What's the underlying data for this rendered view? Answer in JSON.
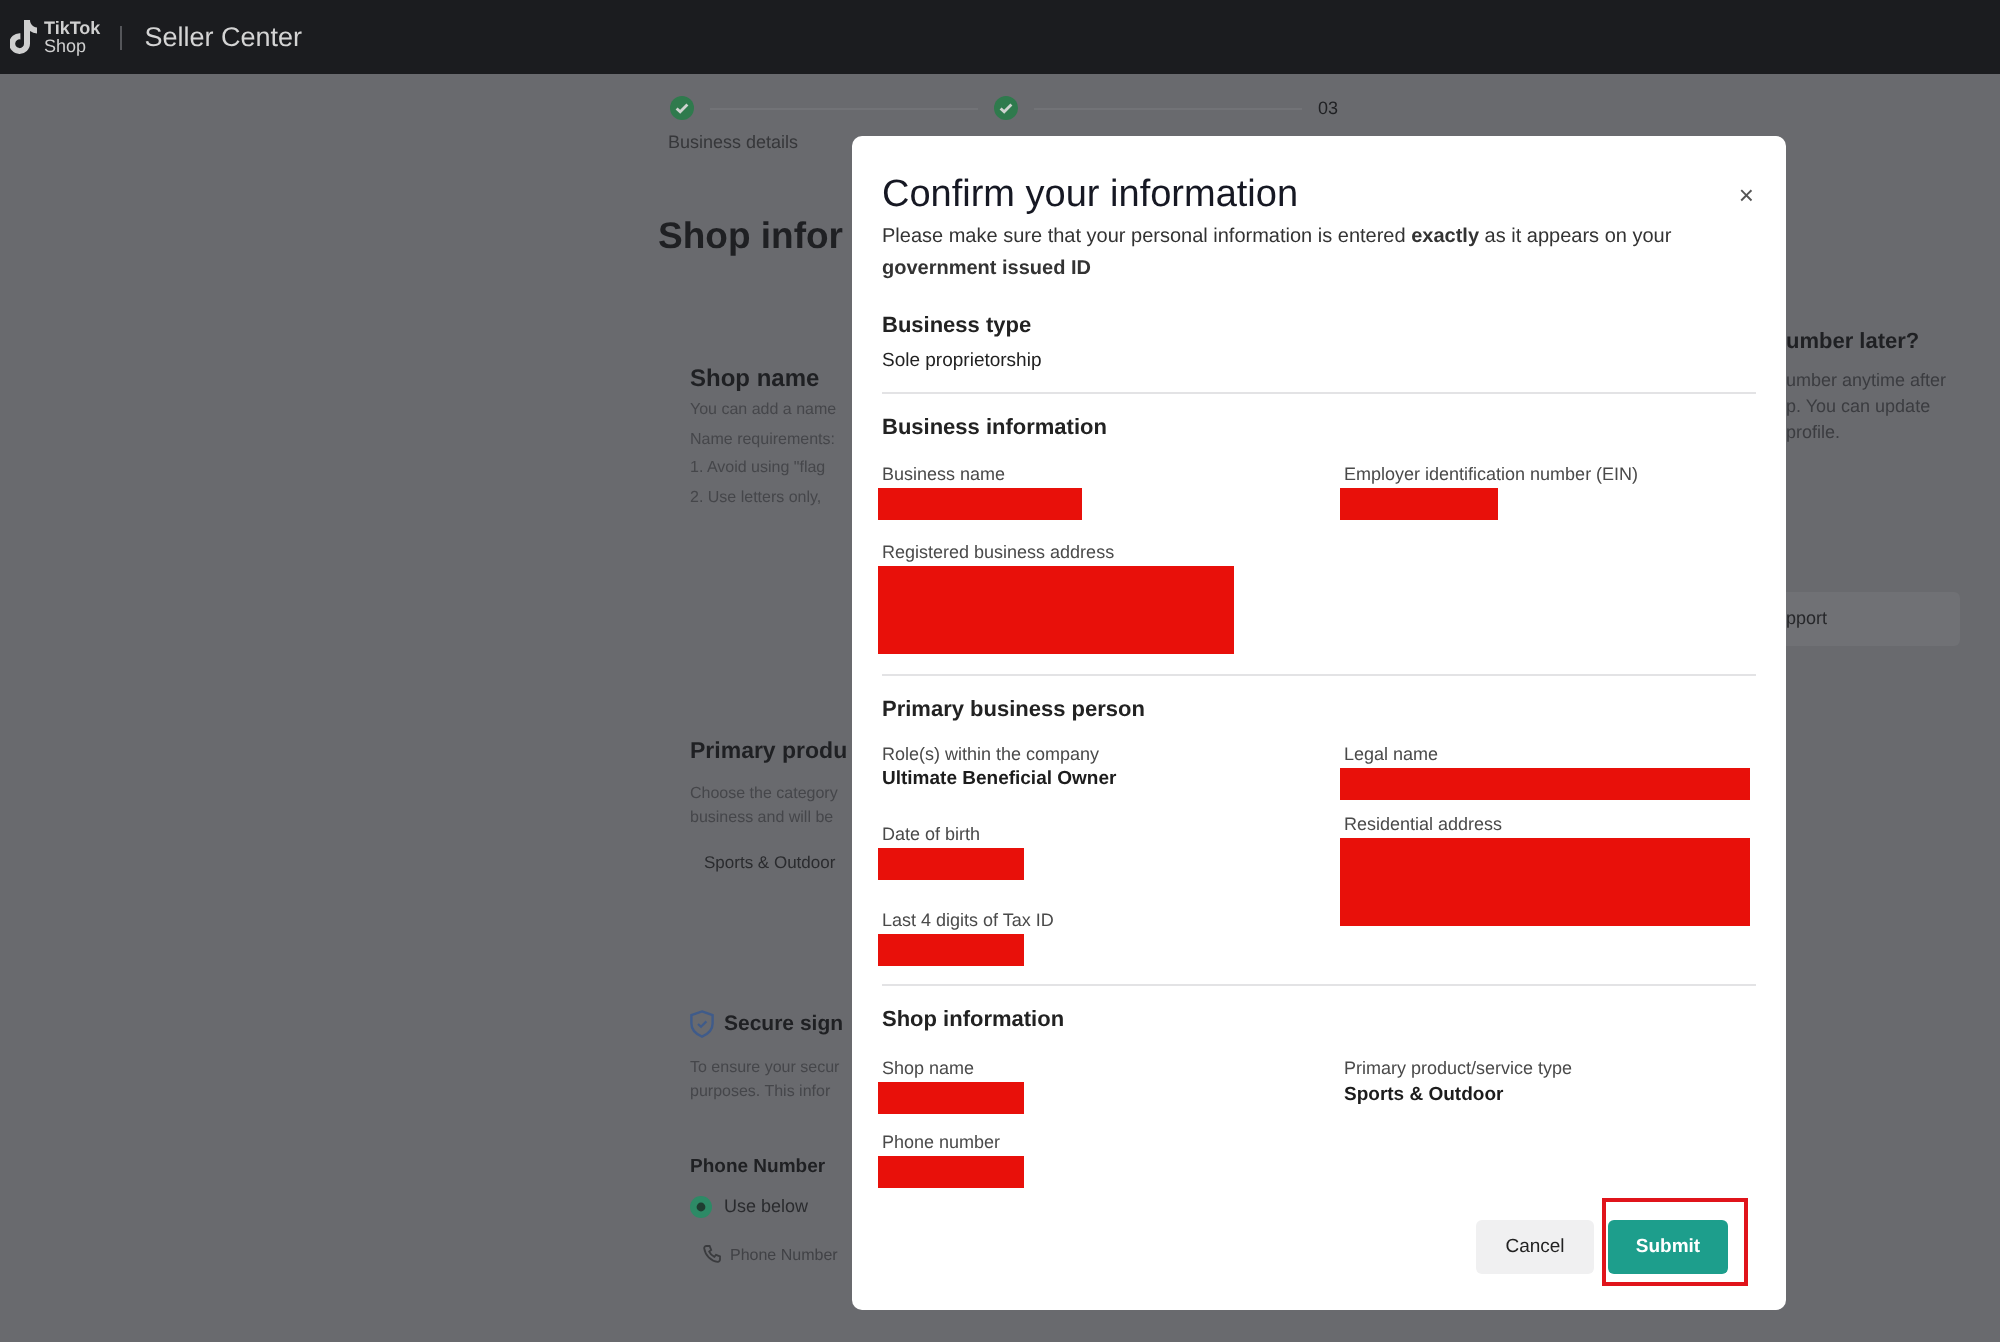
{
  "header": {
    "logo_line_1": "TikTok",
    "logo_line_2": "Shop",
    "title": "Seller Center"
  },
  "stepper": [
    {
      "done": true,
      "label": "Business details"
    },
    {
      "done": true
    },
    {
      "done": false,
      "number": "03"
    }
  ],
  "page": {
    "title": "Shop infor",
    "shop_name": {
      "heading": "Shop name",
      "lines": [
        "You can add a name",
        "Name requirements:",
        "1. Avoid using \"flag",
        "2. Use letters only,"
      ]
    },
    "primary_product": {
      "heading": "Primary produ",
      "lines": [
        "Choose the category",
        "business and will be"
      ],
      "chip": "Sports & Outdoor"
    },
    "secure_sign": {
      "heading": "Secure sign",
      "lines": [
        "To ensure your secur",
        "purposes. This infor"
      ],
      "phone_label": "Phone Number",
      "radio": {
        "label": "Use below",
        "checked": true
      },
      "phone_field": {
        "placeholder": "Phone Number"
      }
    },
    "side_card": {
      "heading": "umber later?",
      "lines": [
        "umber anytime after",
        "p. You can update",
        "profile."
      ],
      "button": "pport"
    }
  },
  "dialog": {
    "title": "Confirm your information",
    "close": "×",
    "subtitle": "Please make sure that your personal information is entered **exactly** as it appears on your **government issued ID**",
    "sections": [
      {
        "kind": "summary",
        "heading": "Business type",
        "value": "Sole proprietorship"
      },
      {
        "kind": "fields",
        "heading": "Business information",
        "columns": [
          [
            {
              "label": "Business name",
              "redacted": true,
              "multiline": false
            },
            {
              "label": "Registered business address",
              "redacted": true,
              "multiline": true
            }
          ],
          [
            {
              "label": "Employer identification number (EIN)",
              "redacted": true,
              "multiline": false
            }
          ]
        ]
      },
      {
        "kind": "fields",
        "heading": "Primary business person",
        "columns": [
          [
            {
              "label": "Role(s) within the company",
              "redacted": false,
              "value": "Ultimate Beneficial Owner"
            },
            {
              "label": "Date of birth",
              "redacted": true,
              "multiline": false
            },
            {
              "label": "Last 4 digits of Tax ID",
              "redacted": true,
              "multiline": false
            }
          ],
          [
            {
              "label": "Legal name",
              "redacted": true,
              "multiline": false
            },
            {
              "label": "Residential address",
              "redacted": true,
              "multiline": true
            }
          ]
        ]
      },
      {
        "kind": "fields",
        "heading": "Shop information",
        "columns": [
          [
            {
              "label": "Shop name",
              "redacted": true,
              "multiline": false
            },
            {
              "label": "Phone number",
              "redacted": true,
              "multiline": false
            }
          ],
          [
            {
              "label": "Primary product/service type",
              "redacted": false,
              "value": "Sports & Outdoor"
            }
          ]
        ]
      }
    ],
    "buttons": [
      {
        "label": "Cancel",
        "kind": "secondary",
        "highlighted": false
      },
      {
        "label": "Submit",
        "kind": "primary",
        "highlighted": true
      }
    ]
  }
}
